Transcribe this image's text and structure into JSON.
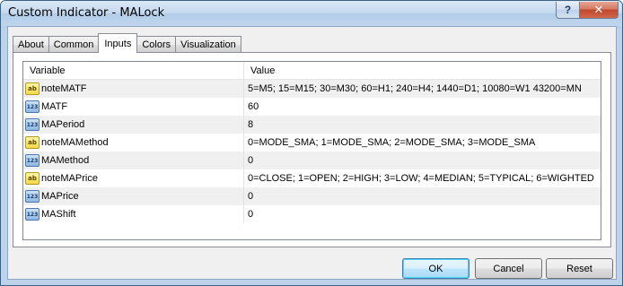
{
  "window": {
    "title": "Custom Indicator - MALock",
    "help_label": "?",
    "close_label": "✕"
  },
  "tabs": [
    {
      "label": "About"
    },
    {
      "label": "Common"
    },
    {
      "label": "Inputs"
    },
    {
      "label": "Colors"
    },
    {
      "label": "Visualization"
    }
  ],
  "active_tab": "Inputs",
  "grid": {
    "headers": {
      "variable": "Variable",
      "value": "Value"
    },
    "rows": [
      {
        "type": "string",
        "icon": "ab",
        "variable": "noteMATF",
        "value": "5=M5; 15=M15; 30=M30; 60=H1; 240=H4; 1440=D1; 10080=W1 43200=MN"
      },
      {
        "type": "integer",
        "icon": "123",
        "variable": "MATF",
        "value": "60"
      },
      {
        "type": "integer",
        "icon": "123",
        "variable": "MAPeriod",
        "value": "8"
      },
      {
        "type": "string",
        "icon": "ab",
        "variable": "noteMAMethod",
        "value": "0=MODE_SMA; 1=MODE_SMA; 2=MODE_SMA; 3=MODE_SMA"
      },
      {
        "type": "integer",
        "icon": "123",
        "variable": "MAMethod",
        "value": "0"
      },
      {
        "type": "string",
        "icon": "ab",
        "variable": "noteMAPrice",
        "value": "0=CLOSE; 1=OPEN; 2=HIGH; 3=LOW; 4=MEDIAN; 5=TYPICAL; 6=WIGHTED"
      },
      {
        "type": "integer",
        "icon": "123",
        "variable": "MAPrice",
        "value": "0"
      },
      {
        "type": "integer",
        "icon": "123",
        "variable": "MAShift",
        "value": "0"
      }
    ]
  },
  "buttons": {
    "ok": "OK",
    "cancel": "Cancel",
    "reset": "Reset"
  }
}
